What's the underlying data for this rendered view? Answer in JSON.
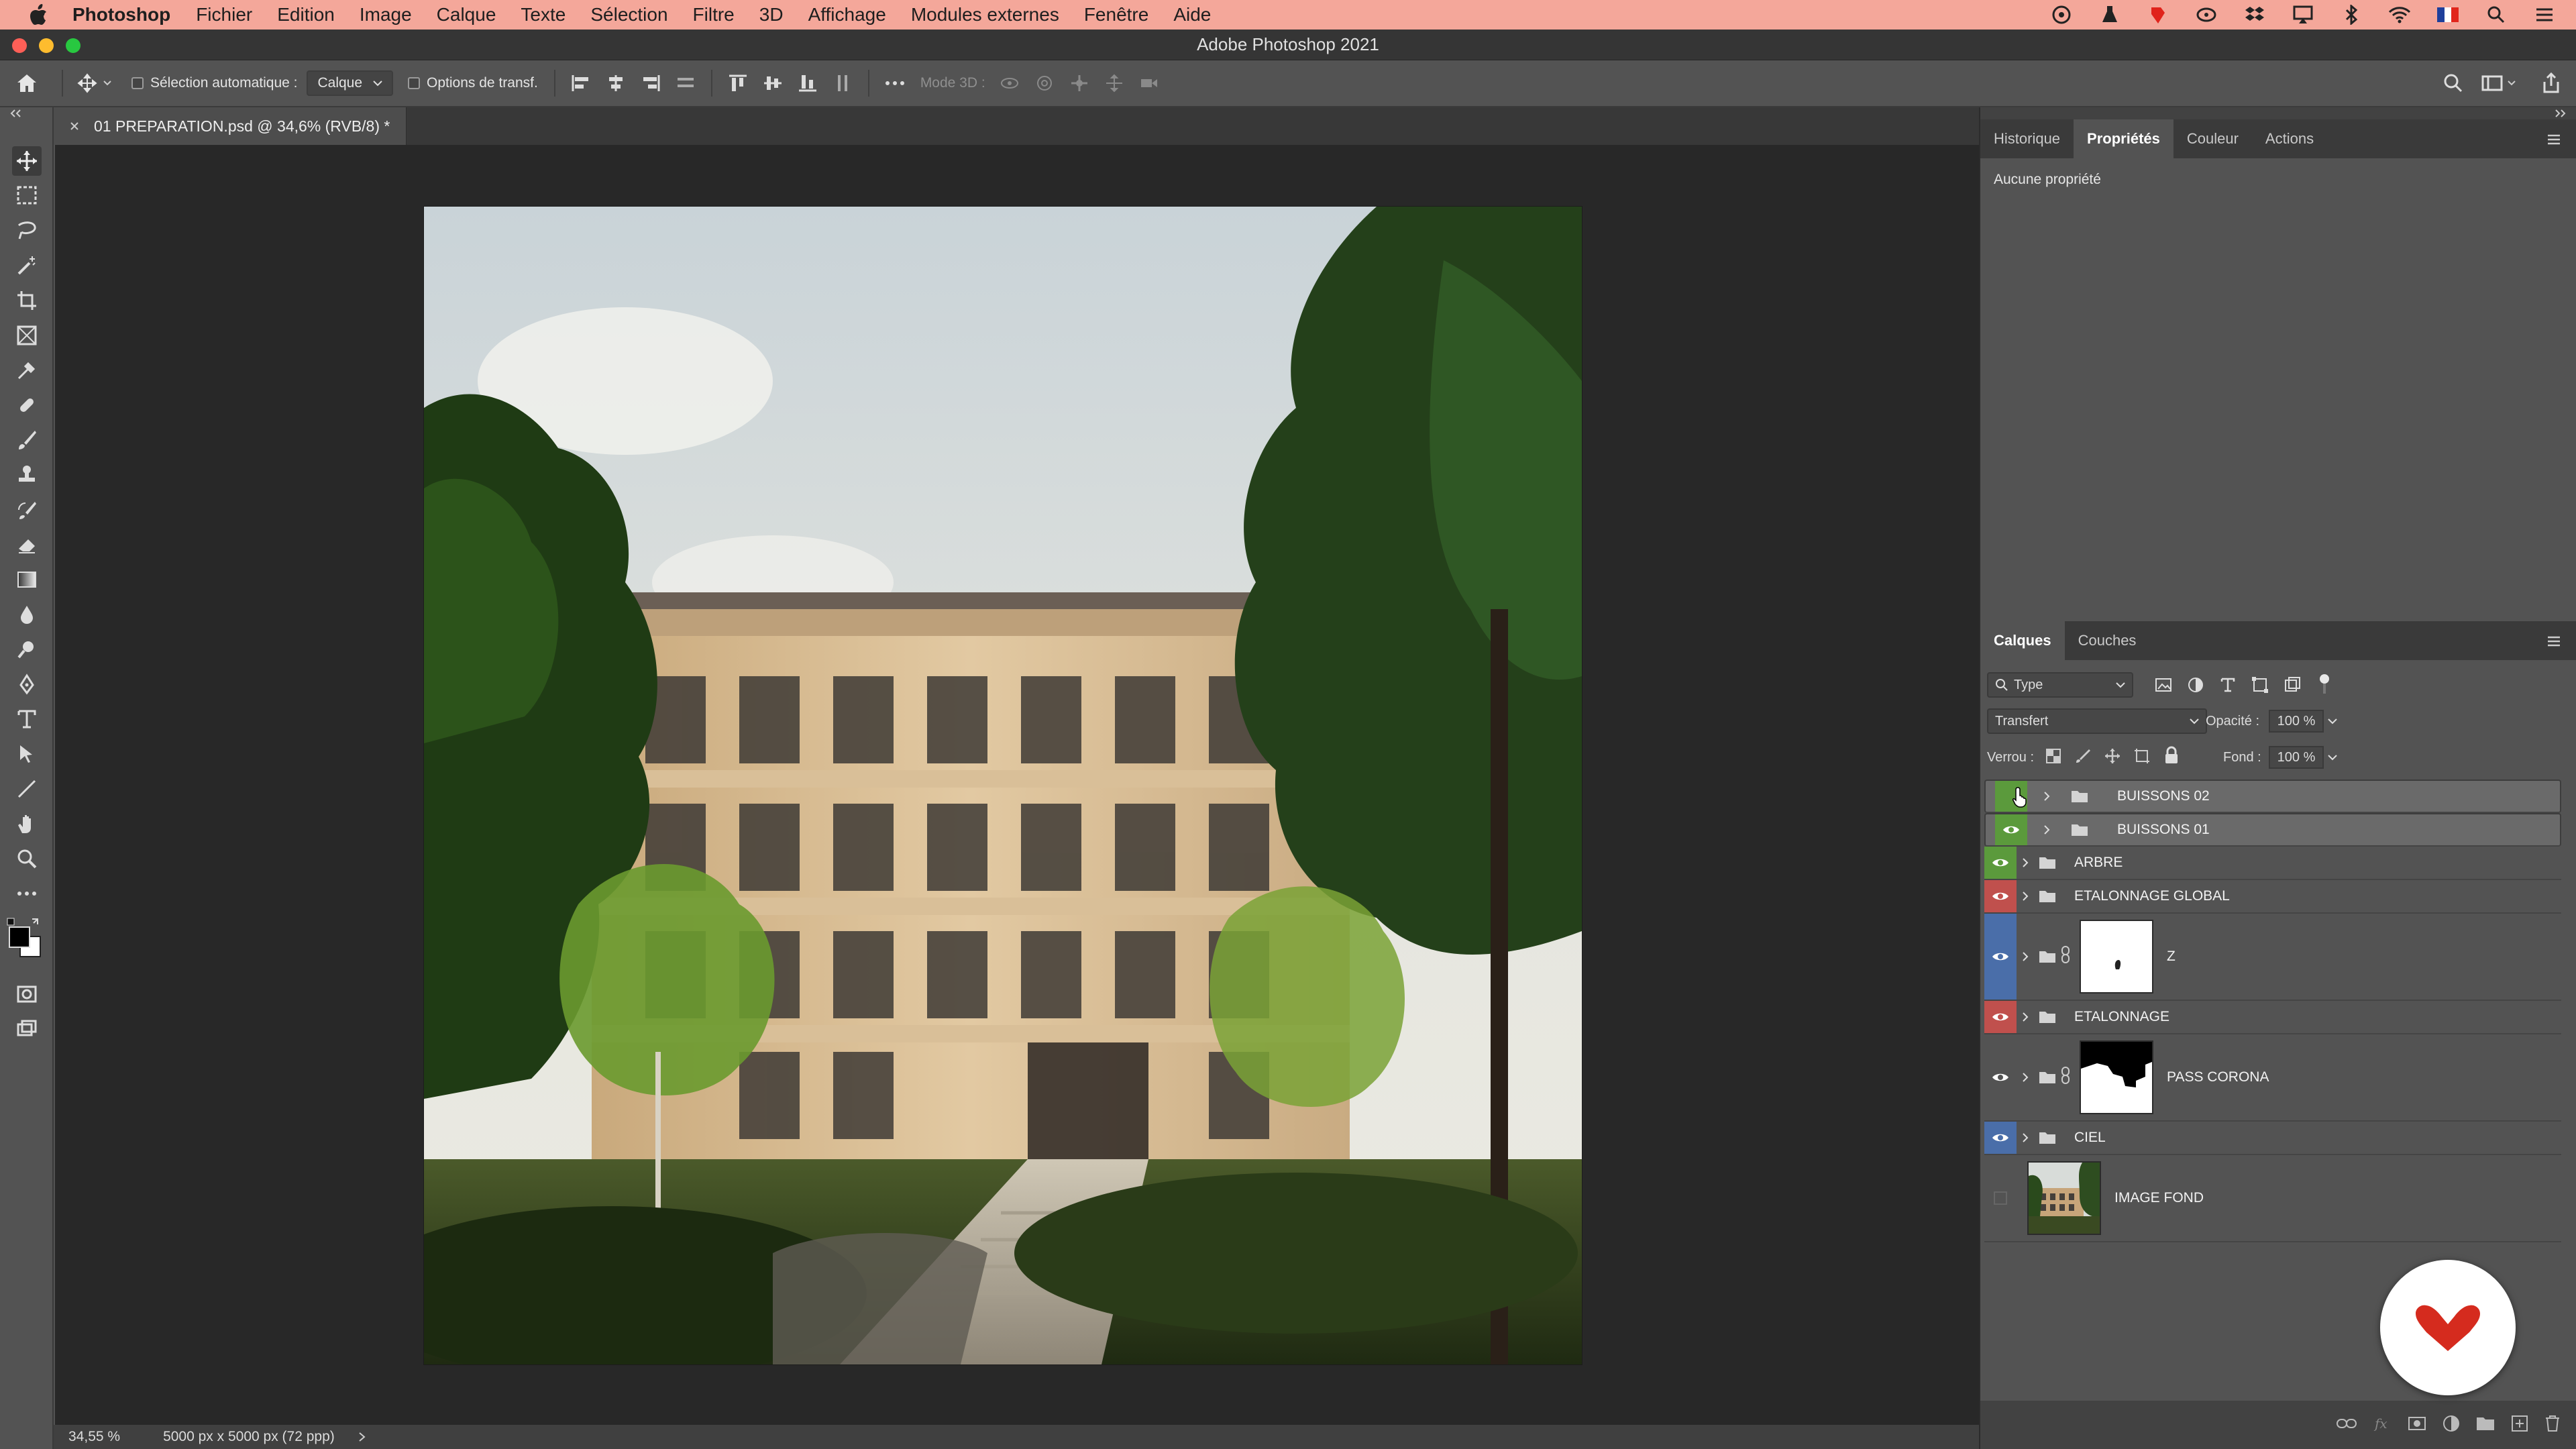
{
  "menubar": {
    "app_name": "Photoshop",
    "items": [
      "Fichier",
      "Edition",
      "Image",
      "Calque",
      "Texte",
      "Sélection",
      "Filtre",
      "3D",
      "Affichage",
      "Modules externes",
      "Fenêtre",
      "Aide"
    ]
  },
  "window": {
    "title": "Adobe Photoshop 2021"
  },
  "options_bar": {
    "auto_select_label": "Sélection automatique :",
    "auto_select_value": "Calque",
    "transform_controls_label": "Options de transf.",
    "mode_3d_label": "Mode 3D :"
  },
  "document_tab": {
    "title": "01 PREPARATION.psd @ 34,6% (RVB/8) *"
  },
  "status_bar": {
    "zoom": "34,55 %",
    "doc_size": "5000 px x 5000 px (72 ppp)"
  },
  "properties_panel": {
    "tabs": [
      "Historique",
      "Propriétés",
      "Couleur",
      "Actions"
    ],
    "active_tab": "Propriétés",
    "empty_text": "Aucune propriété"
  },
  "layers_panel": {
    "tabs": [
      "Calques",
      "Couches"
    ],
    "active_tab": "Calques",
    "filter_value": "Type",
    "blend_mode": "Transfert",
    "opacity_label": "Opacité :",
    "opacity_value": "100 %",
    "lock_label": "Verrou :",
    "fill_label": "Fond :",
    "fill_value": "100 %",
    "layers": [
      {
        "name": "BUISSONS 02",
        "color": "#5b9a3c",
        "visible": false,
        "selected": true,
        "type": "group"
      },
      {
        "name": "BUISSONS 01",
        "color": "#5b9a3c",
        "visible": true,
        "selected": true,
        "type": "group"
      },
      {
        "name": "ARBRE",
        "color": "#5b9a3c",
        "visible": true,
        "selected": false,
        "type": "group"
      },
      {
        "name": "ETALONNAGE GLOBAL",
        "color": "#c0504d",
        "visible": true,
        "selected": false,
        "type": "group"
      },
      {
        "name": "Z",
        "color": "#4a6ea9",
        "visible": true,
        "selected": false,
        "type": "group-mask"
      },
      {
        "name": "ETALONNAGE",
        "color": "#c0504d",
        "visible": true,
        "selected": false,
        "type": "group"
      },
      {
        "name": "PASS CORONA",
        "color": "",
        "visible": true,
        "selected": false,
        "type": "group-mask"
      },
      {
        "name": "CIEL",
        "color": "#4a6ea9",
        "visible": true,
        "selected": false,
        "type": "group"
      },
      {
        "name": "IMAGE FOND",
        "color": "",
        "visible": false,
        "selected": false,
        "type": "image"
      }
    ]
  },
  "colors": {
    "accent_red": "#d52b1e",
    "menubar_bg": "#f4a79a"
  }
}
